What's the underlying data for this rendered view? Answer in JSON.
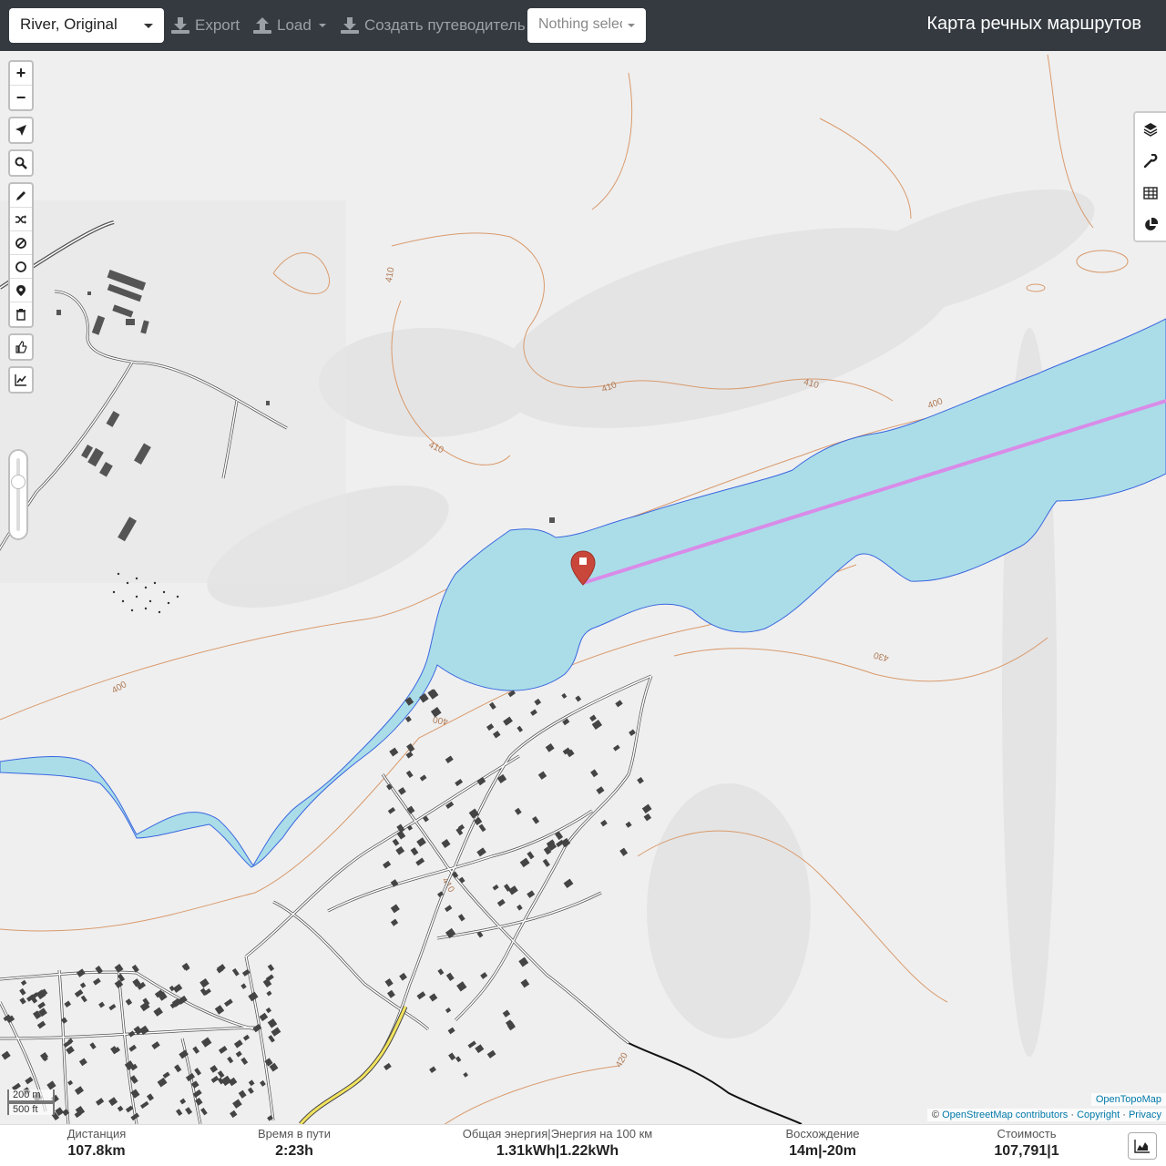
{
  "navbar": {
    "profile": "River, Original",
    "export_label": "Export",
    "load_label": "Load",
    "guide_label": "Создать путеводитель",
    "selection_placeholder": "Nothing selected",
    "app_title": "Карта речных маршрутов"
  },
  "map_controls": {
    "zoom_in": "+",
    "zoom_out": "−"
  },
  "map_labels": {
    "contour_410_a": "410",
    "contour_410_b": "410",
    "contour_410_c": "410",
    "contour_410_d": "410",
    "contour_400_a": "400",
    "contour_400_b": "400",
    "contour_400_c": "400",
    "contour_430": "430",
    "contour_420": "420",
    "contour_410_e": "410"
  },
  "scale": {
    "metric": "200 m",
    "imperial": "500 ft"
  },
  "attribution": {
    "opentopomap": "OpenTopoMap",
    "prefix": "©",
    "osm": "OpenStreetMap contributors",
    "sep1": "·",
    "copyright": "Copyright",
    "sep2": "·",
    "privacy": "Privacy"
  },
  "stats": {
    "distance_label": "Дистанция",
    "distance_value": "107.8",
    "distance_unit": "km",
    "time_label": "Время в пути",
    "time_value": "2:23",
    "time_unit": "h",
    "energy_label": "Общая энергия|Энергия на 100 км",
    "energy_total": "1.31",
    "energy_total_unit": "kWh",
    "energy_sep": "|",
    "energy_per100": "1.22",
    "energy_per100_unit": "kWh",
    "ascent_label": "Восхождение",
    "ascent_up": "14",
    "ascent_up_unit": "m",
    "ascent_sep": "|",
    "ascent_down": "-20",
    "ascent_down_unit": "m",
    "cost_label": "Стоимость",
    "cost_value": "107,791",
    "cost_sep": "|",
    "cost_count": "1"
  },
  "colors": {
    "navbar": "#343a40",
    "water": "#aadde8",
    "water_edge": "#3a66e0",
    "route": "#d98be8",
    "marker": "#c9473a",
    "contour": "#d99a6c"
  }
}
